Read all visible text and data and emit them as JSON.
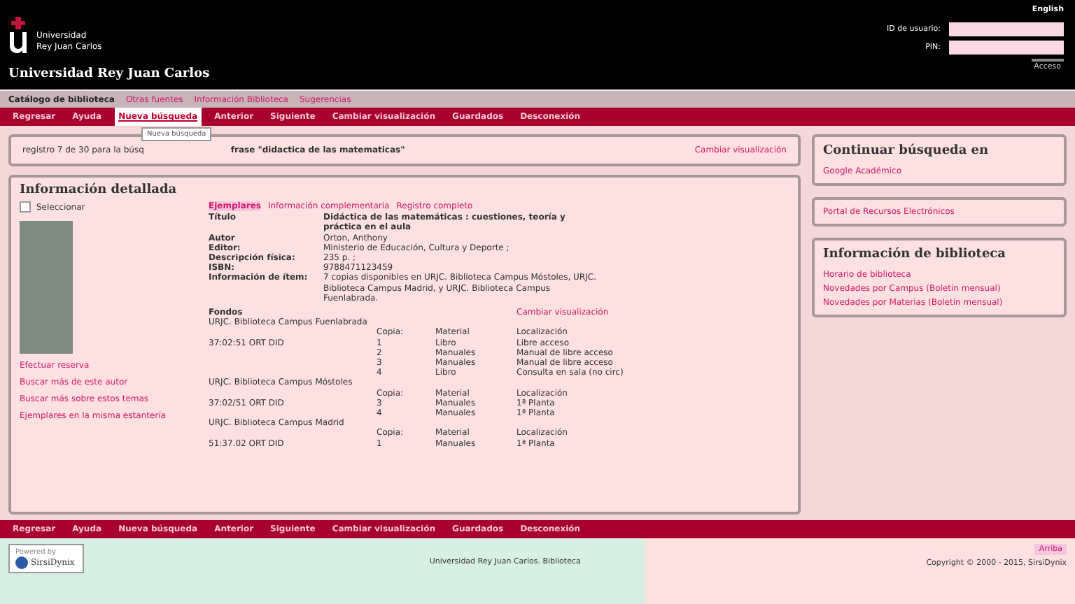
{
  "header": {
    "logo_line1": "Universidad",
    "logo_line2": "Rey Juan Carlos",
    "site_title": "Universidad Rey Juan Carlos",
    "language_link": "English",
    "user_id_label": "ID de usuario:",
    "pin_label": "PIN:",
    "login_button": "Acceso"
  },
  "top_tabs": [
    {
      "label": "Catálogo de biblioteca",
      "selected": true
    },
    {
      "label": "Otras fuentes",
      "selected": false
    },
    {
      "label": "Información Biblioteca",
      "selected": false
    },
    {
      "label": "Sugerencias",
      "selected": false
    }
  ],
  "nav_bar": [
    {
      "label": "Regresar",
      "selected": false
    },
    {
      "label": "Ayuda",
      "selected": false
    },
    {
      "label": "Nueva búsqueda",
      "selected": true
    },
    {
      "label": "Anterior",
      "selected": false
    },
    {
      "label": "Siguiente",
      "selected": false
    },
    {
      "label": "Cambiar visualización",
      "selected": false
    },
    {
      "label": "Guardados",
      "selected": false
    },
    {
      "label": "Desconexión",
      "selected": false
    }
  ],
  "tooltip": "Nueva búsqueda",
  "summary": {
    "text_start": "registro 7 de 30 para la búsq",
    "text_end": "frase \"didactica de las matematicas\"",
    "change_view_link": "Cambiar visualización"
  },
  "detail": {
    "heading": "Información detallada",
    "select_checkbox": {
      "label": "Seleccionar",
      "checked": false
    },
    "actions": [
      "Efectuar reserva",
      "Buscar más de este autor",
      "Buscar más sobre estos temas",
      "Ejemplares en la misma estantería"
    ],
    "tabs": [
      {
        "label": "Ejemplares",
        "selected": true
      },
      {
        "label": "Información complementaria",
        "selected": false
      },
      {
        "label": "Registro completo",
        "selected": false
      }
    ],
    "fields": [
      {
        "label": "Título",
        "value": "Didáctica de las matemáticas : cuestiones, teoría y práctica en el aula",
        "kind": "title"
      },
      {
        "label": "Autor",
        "value": "Orton, Anthony",
        "kind": "plain"
      },
      {
        "label": "Editor:",
        "value": "Ministerio de Educación, Cultura y Deporte ;",
        "kind": "plain"
      },
      {
        "label": "Descripción física:",
        "value": "235 p. ;",
        "kind": "plain"
      },
      {
        "label": "ISBN:",
        "value": "9788471123459",
        "kind": "plain"
      },
      {
        "label": "Información de ítem:",
        "value": "7 copias disponibles en URJC. Biblioteca Campus Móstoles, URJC. Biblioteca Campus Madrid, y URJC. Biblioteca Campus Fuenlabrada.",
        "kind": "plain"
      }
    ],
    "holdings": {
      "heading": "Fondos",
      "change_view_link": "Cambiar visualización",
      "groups": [
        {
          "library": "URJC. Biblioteca Campus Fuenlabrada",
          "columns": [
            "Copia:",
            "Material",
            "Localización"
          ],
          "rows": [
            {
              "call_number": "37:02:51 ORT DID",
              "copy": "1",
              "material": "Libro",
              "location": "Libre acceso"
            },
            {
              "copy": "2",
              "material": "Manuales",
              "location": "Manual de libre acceso"
            },
            {
              "copy": "3",
              "material": "Manuales",
              "location": "Manual de libre acceso"
            },
            {
              "copy": "4",
              "material": "Libro",
              "location": "Consulta en sala (no circ)"
            }
          ]
        },
        {
          "library": "URJC. Biblioteca Campus Móstoles",
          "columns": [
            "Copia:",
            "Material",
            "Localización"
          ],
          "rows": [
            {
              "call_number": "37:02/51 ORT DID",
              "copy": "3",
              "material": "Manuales",
              "location": "1ª Planta"
            },
            {
              "copy": "4",
              "material": "Manuales",
              "location": "1ª Planta"
            }
          ]
        },
        {
          "library": "URJC. Biblioteca Campus Madrid",
          "columns": [
            "Copia:",
            "Material",
            "Localización"
          ],
          "rows": [
            {
              "call_number": "51:37.02 ORT DID",
              "copy": "1",
              "material": "Manuales",
              "location": "1ª Planta"
            }
          ]
        }
      ]
    }
  },
  "sidebar": [
    {
      "heading": "Continuar búsqueda en",
      "links": [
        "Google Académico"
      ]
    },
    {
      "links": [
        "Portal de Recursos Electrónicos"
      ]
    },
    {
      "heading": "Información de biblioteca",
      "links": [
        "Horario de biblioteca",
        "Novedades por Campus (Boletín mensual)",
        "Novedades por Materias (Boletín mensual)"
      ]
    }
  ],
  "bottom_nav": [
    {
      "label": "Regresar"
    },
    {
      "label": "Ayuda"
    },
    {
      "label": "Nueva búsqueda"
    },
    {
      "label": "Anterior"
    },
    {
      "label": "Siguiente"
    },
    {
      "label": "Cambiar visualización"
    },
    {
      "label": "Guardados"
    },
    {
      "label": "Desconexión"
    }
  ],
  "footer": {
    "powered_by": "Powered by",
    "vendor": "SirsiDynix",
    "center_text": "Universidad Rey Juan Carlos. Biblioteca",
    "top_link": "Arriba",
    "copyright": "Copyright © 2000 - 2015, SirsiDynix"
  }
}
